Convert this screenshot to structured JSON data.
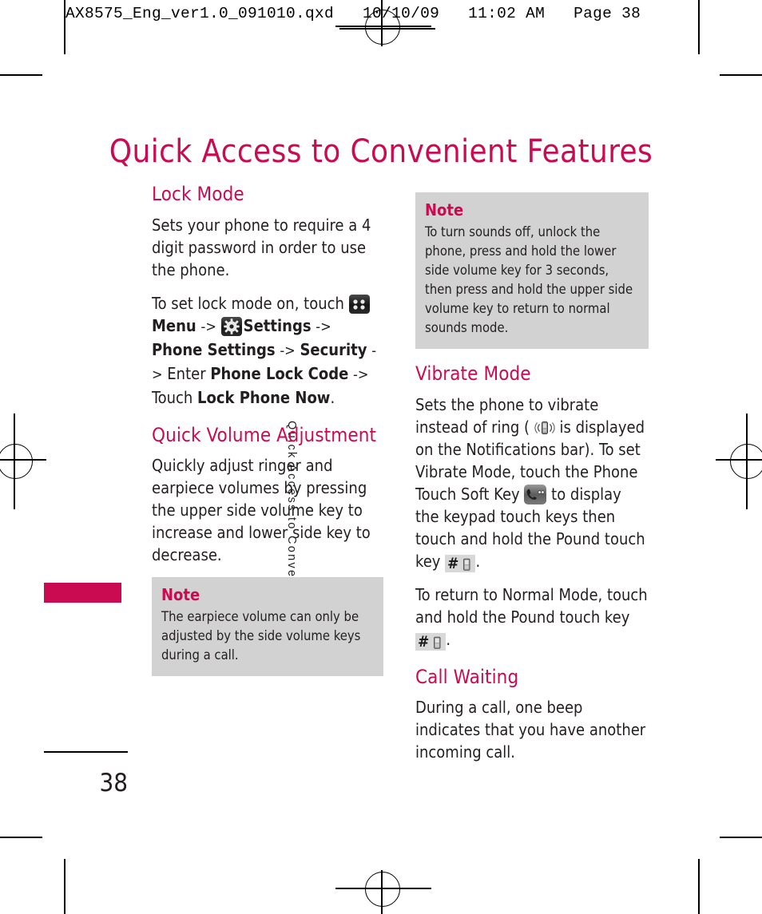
{
  "prepress": {
    "slug": "AX8575_Eng_ver1.0_091010.qxd   10/10/09   11:02 AM   Page 38"
  },
  "colors": {
    "accent": "#cb0b51",
    "text": "#231f20",
    "note_background": "#d2d2d2"
  },
  "page": {
    "title": "Quick Access to Convenient Features",
    "side_label": "Quick Access to Convenient Features",
    "number": "38"
  },
  "left_column": {
    "lock_mode": {
      "heading": "Lock Mode",
      "paragraph_1": "Sets your phone to require a 4 digit password in order to use the phone.",
      "steps_intro": "To set lock mode on, touch",
      "step_menu": "Menu",
      "arrow_1": "->",
      "step_settings": "Settings",
      "arrow_2": "->",
      "step_phone_settings": "Phone Settings",
      "arrow_3": "->",
      "step_security": "Security",
      "arrow_4": "->",
      "enter_word": "Enter",
      "step_phone_lock_code": "Phone Lock Code",
      "arrow_5": "->",
      "touch_word": "Touch",
      "step_lock_phone_now": "Lock Phone Now",
      "period": "."
    },
    "quick_volume": {
      "heading": "Quick Volume Adjustment",
      "paragraph": "Quickly adjust ringer and earpiece volumes by pressing the upper side volume key to increase and lower side key to decrease."
    },
    "note": {
      "title": "Note",
      "body": "The earpiece volume can only be adjusted by the side volume keys during a call."
    }
  },
  "right_column": {
    "note": {
      "title": "Note",
      "body": "To turn sounds off, unlock the phone, press and hold the lower side volume key for 3 seconds, then press and hold the upper side volume key to return to normal sounds mode."
    },
    "vibrate_mode": {
      "heading": "Vibrate Mode",
      "text_part_1": "Sets the phone to vibrate instead of ring (",
      "text_part_2": "is displayed on the Notifications bar). To set Vibrate Mode, touch the Phone Touch Soft Key",
      "text_part_3": "to display the keypad touch keys then touch and hold the Pound touch key",
      "pound_symbol": "#",
      "text_part_4": "."
    },
    "return_normal": {
      "text_part_1": "To return to Normal Mode, touch and hold the Pound touch key",
      "pound_symbol": "#",
      "text_part_2": "."
    },
    "call_waiting": {
      "heading": "Call Waiting",
      "paragraph": "During a call, one beep indicates that you have another incoming call."
    }
  },
  "icons": {
    "menu": "menu-grid-icon",
    "settings": "gear-icon",
    "vibrate": "vibrate-phone-icon",
    "soft_key": "phone-handset-icon",
    "pound_key": "pound-key-icon"
  }
}
